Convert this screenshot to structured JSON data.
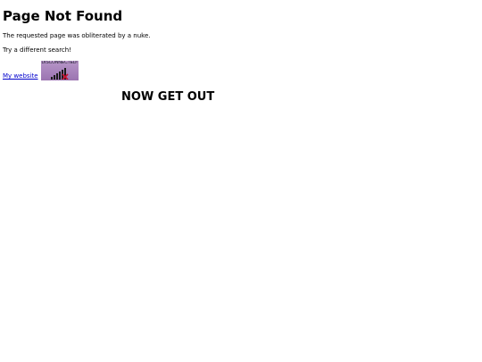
{
  "heading": "Page Not Found",
  "messages": [
    "The requested page was obliterated by a nuke.",
    "Try a different search!"
  ],
  "link": {
    "label": "My website"
  },
  "banner": {
    "text": "DISCONNECTED!",
    "icon": "signal-bars-disconnected"
  },
  "cta": "NOW GET OUT"
}
